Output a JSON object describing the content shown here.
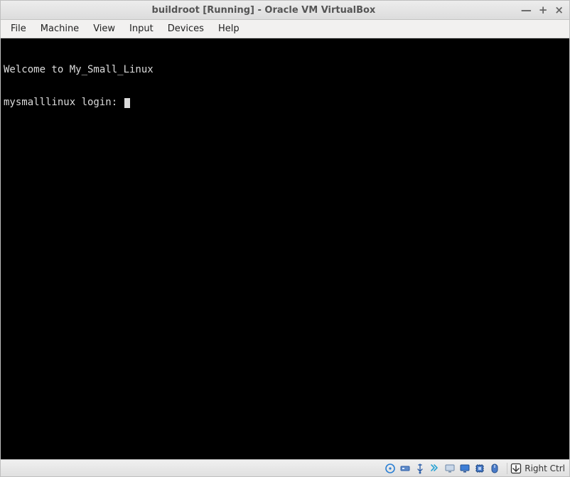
{
  "window": {
    "title": "buildroot [Running] - Oracle VM VirtualBox"
  },
  "menu": {
    "items": [
      {
        "label": "File"
      },
      {
        "label": "Machine"
      },
      {
        "label": "View"
      },
      {
        "label": "Input"
      },
      {
        "label": "Devices"
      },
      {
        "label": "Help"
      }
    ]
  },
  "console": {
    "lines": [
      "Welcome to My_Small_Linux",
      "mysmalllinux login: "
    ]
  },
  "status": {
    "icons": [
      {
        "name": "hard-disk-icon"
      },
      {
        "name": "optical-drive-icon"
      },
      {
        "name": "usb-icon"
      },
      {
        "name": "shared-folder-icon"
      },
      {
        "name": "display-icon"
      },
      {
        "name": "recording-icon"
      },
      {
        "name": "cpu-icon"
      },
      {
        "name": "mouse-integration-icon"
      },
      {
        "name": "host-key-icon"
      }
    ],
    "host_key_label": "Right Ctrl"
  }
}
